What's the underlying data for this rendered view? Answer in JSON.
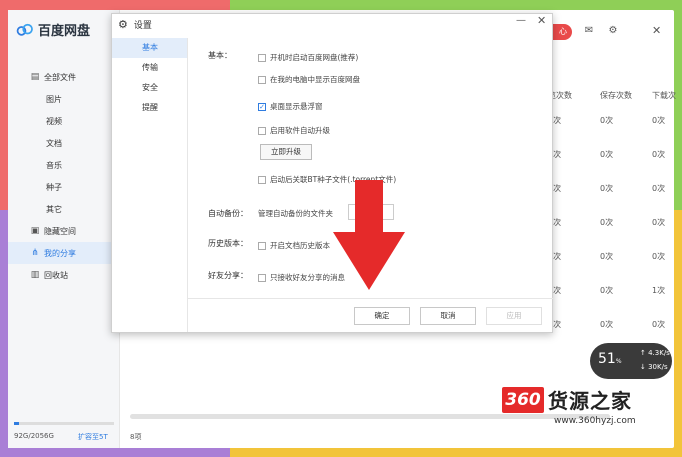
{
  "app": {
    "name": "百度网盘",
    "header_badge": "心",
    "sidebar": {
      "items": [
        {
          "label": "全部文件",
          "icon": "file-icon",
          "type": "main"
        },
        {
          "label": "图片",
          "type": "sub"
        },
        {
          "label": "视频",
          "type": "sub"
        },
        {
          "label": "文档",
          "type": "sub"
        },
        {
          "label": "音乐",
          "type": "sub"
        },
        {
          "label": "种子",
          "type": "sub"
        },
        {
          "label": "其它",
          "type": "sub"
        },
        {
          "label": "隐藏空间",
          "icon": "lock-icon",
          "type": "main"
        },
        {
          "label": "我的分享",
          "icon": "share-icon",
          "type": "main",
          "active": true
        },
        {
          "label": "回收站",
          "icon": "trash-icon",
          "type": "main"
        }
      ],
      "storage": "92G/2056G",
      "storage_fraction": 0.045,
      "expand_link": "扩容至5T"
    },
    "columns": [
      "浏览次数",
      "保存次数",
      "下载次数"
    ],
    "column_headers_visible": [
      "览次数",
      "保存次数",
      "下载次"
    ],
    "rows": [
      [
        "0次",
        "0次",
        "0次"
      ],
      [
        "0次",
        "0次",
        "0次"
      ],
      [
        "0次",
        "0次",
        "0次"
      ],
      [
        "0次",
        "0次",
        "0次"
      ],
      [
        "0次",
        "0次",
        "0次"
      ],
      [
        "0次",
        "0次",
        "1次"
      ],
      [
        "0次",
        "0次",
        "0次"
      ]
    ],
    "status_count": "8项"
  },
  "dialog": {
    "title": "设置",
    "tabs": [
      "基本",
      "传输",
      "安全",
      "提醒"
    ],
    "active_tab": "基本",
    "basic": {
      "label": "基本：",
      "options": [
        {
          "label": "开机时启动百度网盘(推荐)",
          "checked": false
        },
        {
          "label": "在我的电脑中显示百度网盘",
          "checked": false
        },
        {
          "label": "桌面显示悬浮窗",
          "checked": true
        },
        {
          "label": "启用软件自动升级",
          "checked": false
        }
      ],
      "upgrade_button": "立即升级",
      "bt_option": "启动后关联BT种子文件(.torrent文件)"
    },
    "auto_backup": {
      "label": "自动备份：",
      "text": "管理自动备份的文件夹"
    },
    "history": {
      "label": "历史版本：",
      "option": "开启文档历史版本"
    },
    "friend_share": {
      "label": "好友分享：",
      "option": "只接收好友分享的消息"
    },
    "buttons": {
      "ok": "确定",
      "cancel": "取消",
      "apply": "应用"
    }
  },
  "speed_widget": {
    "percent": "51",
    "unit": "%",
    "up": "4.3K/s",
    "down": "30K/s"
  },
  "watermark": {
    "badge": "360",
    "name": "货源之家",
    "url": "www.360hyzj.com"
  },
  "colors": {
    "accent": "#2f7ce0",
    "arrow": "#e52a2a"
  }
}
